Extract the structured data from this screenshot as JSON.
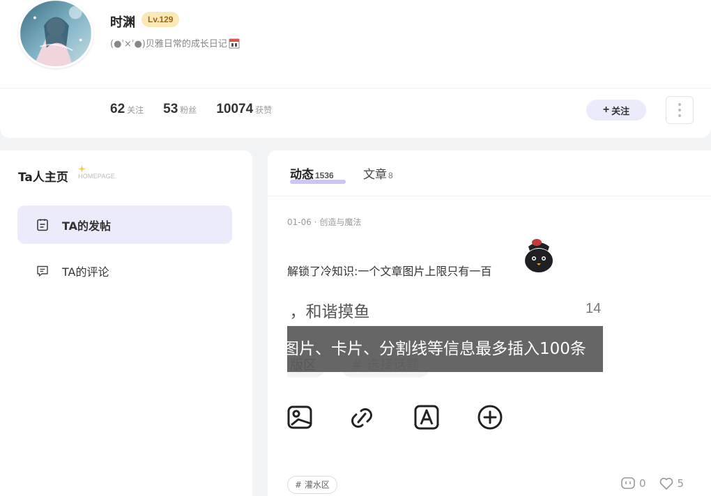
{
  "profile": {
    "username": "时渊",
    "level": "Lv.129",
    "bio": "(●ˈ×ˈ●)贝雅日常的成长日记",
    "stats": [
      {
        "num": "62",
        "label": "关注"
      },
      {
        "num": "53",
        "label": "粉丝"
      },
      {
        "num": "10074",
        "label": "获赞"
      }
    ],
    "follow_label": "关注",
    "follow_plus": "+"
  },
  "left_panel": {
    "title": "Ta人主页",
    "subtitle": "HOMEPAGE.",
    "nav": [
      {
        "label": "TA的发帖",
        "active": true
      },
      {
        "label": "TA的评论",
        "active": false
      }
    ]
  },
  "tabs": [
    {
      "label": "动态",
      "count": "1536"
    },
    {
      "label": "文章",
      "count": "8"
    }
  ],
  "post": {
    "meta": "01-06 · 创造与魔法",
    "text": "解锁了冷知识:一个文章图片上限只有一百",
    "image": {
      "line1": "：，和谐摸鱼",
      "number": "14",
      "ghost_chip1": "版区",
      "ghost_chip2": "# 选择话题",
      "tooltip": "图片、卡片、分割线等信息最多插入100条"
    },
    "tag": "# 灌水区",
    "comments": "0",
    "likes": "5"
  },
  "colors": {
    "accent_bg": "#ecebfb",
    "level_bg": "#fce7b6",
    "tab_underline": "#b9b4f2"
  }
}
